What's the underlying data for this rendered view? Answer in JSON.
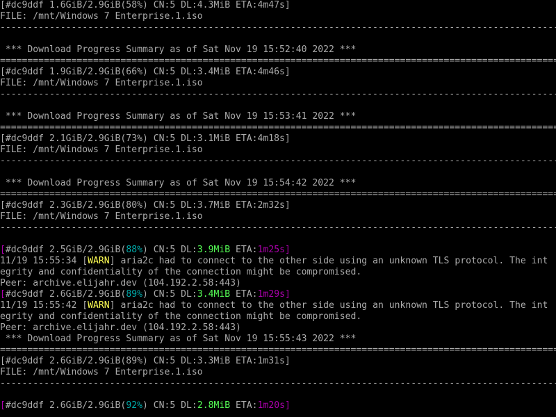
{
  "terminal": {
    "lines": [
      {
        "segments": [
          {
            "text": "[#dc9ddf 1.6GiB/2.9GiB(58%) CN:5 DL:4.3MiB ETA:4m47s]"
          }
        ]
      },
      {
        "segments": [
          {
            "text": "FILE: /mnt/Windows 7 Enterprise.1.iso"
          }
        ]
      },
      {
        "segments": [
          {
            "text": "--------------------------------------------------------------------------------------------------------------"
          }
        ]
      },
      {
        "segments": [
          {
            "text": ""
          }
        ]
      },
      {
        "segments": [
          {
            "text": " *** Download Progress Summary as of Sat Nov 19 15:52:40 2022 ***"
          }
        ]
      },
      {
        "segments": [
          {
            "text": "=============================================================================================================="
          }
        ]
      },
      {
        "segments": [
          {
            "text": "[#dc9ddf 1.9GiB/2.9GiB(66%) CN:5 DL:3.4MiB ETA:4m46s]"
          }
        ]
      },
      {
        "segments": [
          {
            "text": "FILE: /mnt/Windows 7 Enterprise.1.iso"
          }
        ]
      },
      {
        "segments": [
          {
            "text": "--------------------------------------------------------------------------------------------------------------"
          }
        ]
      },
      {
        "segments": [
          {
            "text": ""
          }
        ]
      },
      {
        "segments": [
          {
            "text": " *** Download Progress Summary as of Sat Nov 19 15:53:41 2022 ***"
          }
        ]
      },
      {
        "segments": [
          {
            "text": "=============================================================================================================="
          }
        ]
      },
      {
        "segments": [
          {
            "text": "[#dc9ddf 2.1GiB/2.9GiB(73%) CN:5 DL:3.1MiB ETA:4m18s]"
          }
        ]
      },
      {
        "segments": [
          {
            "text": "FILE: /mnt/Windows 7 Enterprise.1.iso"
          }
        ]
      },
      {
        "segments": [
          {
            "text": "--------------------------------------------------------------------------------------------------------------"
          }
        ]
      },
      {
        "segments": [
          {
            "text": ""
          }
        ]
      },
      {
        "segments": [
          {
            "text": " *** Download Progress Summary as of Sat Nov 19 15:54:42 2022 ***"
          }
        ]
      },
      {
        "segments": [
          {
            "text": "=============================================================================================================="
          }
        ]
      },
      {
        "segments": [
          {
            "text": "[#dc9ddf 2.3GiB/2.9GiB(80%) CN:5 DL:3.7MiB ETA:2m32s]"
          }
        ]
      },
      {
        "segments": [
          {
            "text": "FILE: /mnt/Windows 7 Enterprise.1.iso"
          }
        ]
      },
      {
        "segments": [
          {
            "text": "--------------------------------------------------------------------------------------------------------------"
          }
        ]
      },
      {
        "segments": [
          {
            "text": ""
          }
        ]
      },
      {
        "segments": [
          {
            "text": "[",
            "color": "magenta"
          },
          {
            "text": "#dc9ddf 2.5GiB/2.9GiB("
          },
          {
            "text": "88%",
            "color": "cyan"
          },
          {
            "text": ") CN:5 DL:"
          },
          {
            "text": "3.9MiB",
            "color": "green"
          },
          {
            "text": " ETA:"
          },
          {
            "text": "1m25s",
            "color": "magenta"
          },
          {
            "text": "]",
            "color": "magenta"
          }
        ]
      },
      {
        "segments": [
          {
            "text": "11/19 15:55:34 ["
          },
          {
            "text": "WARN",
            "color": "yellow"
          },
          {
            "text": "] aria2c had to connect to the other side using an unknown TLS protocol. The int"
          }
        ]
      },
      {
        "segments": [
          {
            "text": "egrity and confidentiality of the connection might be compromised."
          }
        ]
      },
      {
        "segments": [
          {
            "text": "Peer: archive.elijahr.dev (104.192.2.58:443)"
          }
        ]
      },
      {
        "segments": [
          {
            "text": "[",
            "color": "magenta"
          },
          {
            "text": "#dc9ddf 2.6GiB/2.9GiB("
          },
          {
            "text": "89%",
            "color": "cyan"
          },
          {
            "text": ") CN:5 DL:"
          },
          {
            "text": "3.4MiB",
            "color": "green"
          },
          {
            "text": " ETA:"
          },
          {
            "text": "1m29s",
            "color": "magenta"
          },
          {
            "text": "]",
            "color": "magenta"
          }
        ]
      },
      {
        "segments": [
          {
            "text": "11/19 15:55:42 ["
          },
          {
            "text": "WARN",
            "color": "yellow"
          },
          {
            "text": "] aria2c had to connect to the other side using an unknown TLS protocol. The int"
          }
        ]
      },
      {
        "segments": [
          {
            "text": "egrity and confidentiality of the connection might be compromised."
          }
        ]
      },
      {
        "segments": [
          {
            "text": "Peer: archive.elijahr.dev (104.192.2.58:443)"
          }
        ]
      },
      {
        "segments": [
          {
            "text": " *** Download Progress Summary as of Sat Nov 19 15:55:43 2022 ***"
          }
        ]
      },
      {
        "segments": [
          {
            "text": "=============================================================================================================="
          }
        ]
      },
      {
        "segments": [
          {
            "text": "[#dc9ddf 2.6GiB/2.9GiB(89%) CN:5 DL:3.3MiB ETA:1m31s]"
          }
        ]
      },
      {
        "segments": [
          {
            "text": "FILE: /mnt/Windows 7 Enterprise.1.iso"
          }
        ]
      },
      {
        "segments": [
          {
            "text": "--------------------------------------------------------------------------------------------------------------"
          }
        ]
      },
      {
        "segments": [
          {
            "text": ""
          }
        ]
      },
      {
        "segments": [
          {
            "text": "[",
            "color": "magenta"
          },
          {
            "text": "#dc9ddf 2.6GiB/2.9GiB("
          },
          {
            "text": "92%",
            "color": "cyan"
          },
          {
            "text": ") CN:5 DL:"
          },
          {
            "text": "2.8MiB",
            "color": "green"
          },
          {
            "text": " ETA:"
          },
          {
            "text": "1m20s",
            "color": "magenta"
          },
          {
            "text": "]",
            "color": "magenta"
          }
        ]
      }
    ]
  },
  "colors": {
    "background": "#000000",
    "default": "#aaaaaa",
    "magenta": "#aa00aa",
    "cyan": "#00aaaa",
    "green": "#55ff55",
    "yellow": "#ffff55"
  }
}
